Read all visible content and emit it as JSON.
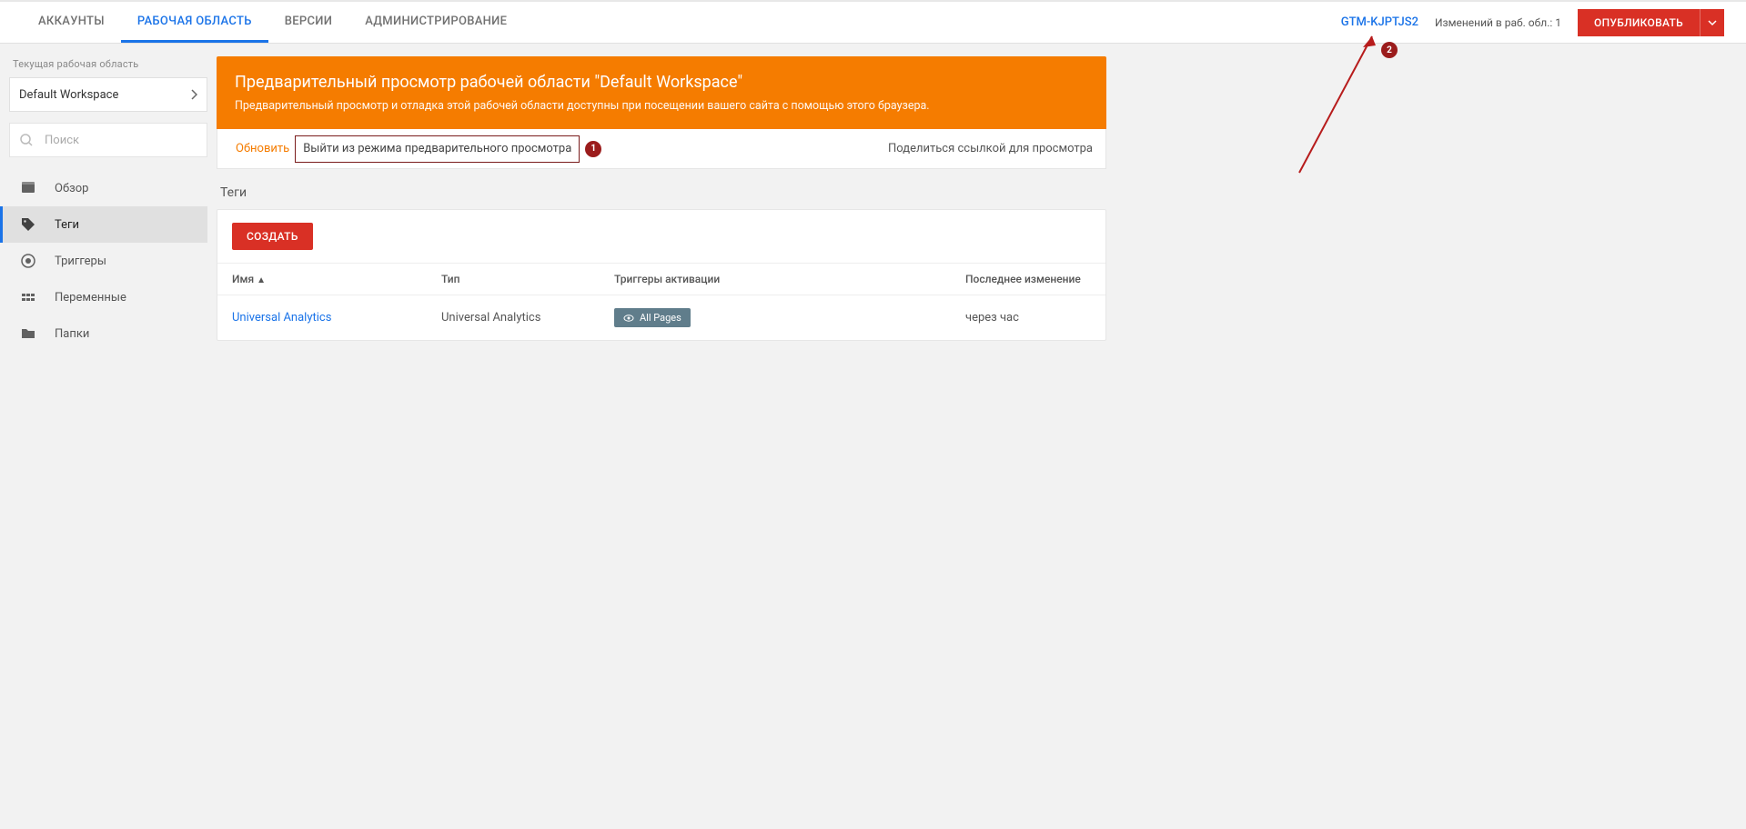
{
  "topnav": {
    "tabs": [
      "АККАУНТЫ",
      "РАБОЧАЯ ОБЛАСТЬ",
      "ВЕРСИИ",
      "АДМИНИСТРИРОВАНИЕ"
    ],
    "active_index": 1,
    "container_id": "GTM-KJPTJS2",
    "changes_label": "Изменений в раб. обл.: 1",
    "publish_label": "ОПУБЛИКОВАТЬ"
  },
  "sidebar": {
    "workspace_heading": "Текущая рабочая область",
    "workspace_name": "Default Workspace",
    "search_placeholder": "Поиск",
    "items": [
      {
        "label": "Обзор",
        "icon": "dashboard"
      },
      {
        "label": "Теги",
        "icon": "tag"
      },
      {
        "label": "Триггеры",
        "icon": "target"
      },
      {
        "label": "Переменные",
        "icon": "bricks"
      },
      {
        "label": "Папки",
        "icon": "folder"
      }
    ],
    "active_index": 1
  },
  "banner": {
    "title": "Предварительный просмотр рабочей области \"Default Workspace\"",
    "subtitle": "Предварительный просмотр и отладка этой рабочей области доступны при посещении вашего сайта с помощью этого браузера.",
    "refresh": "Обновить",
    "exit": "Выйти из режима предварительного просмотра",
    "share": "Поделиться ссылкой для просмотра"
  },
  "section": {
    "title": "Теги",
    "create_button": "СОЗДАТЬ",
    "columns": {
      "name": "Имя",
      "type": "Тип",
      "triggers": "Триггеры активации",
      "modified": "Последнее изменение"
    },
    "rows": [
      {
        "name": "Universal Analytics",
        "type": "Universal Analytics",
        "trigger": "All Pages",
        "modified": "через час"
      }
    ]
  },
  "callouts": {
    "c1": "1",
    "c2": "2"
  }
}
